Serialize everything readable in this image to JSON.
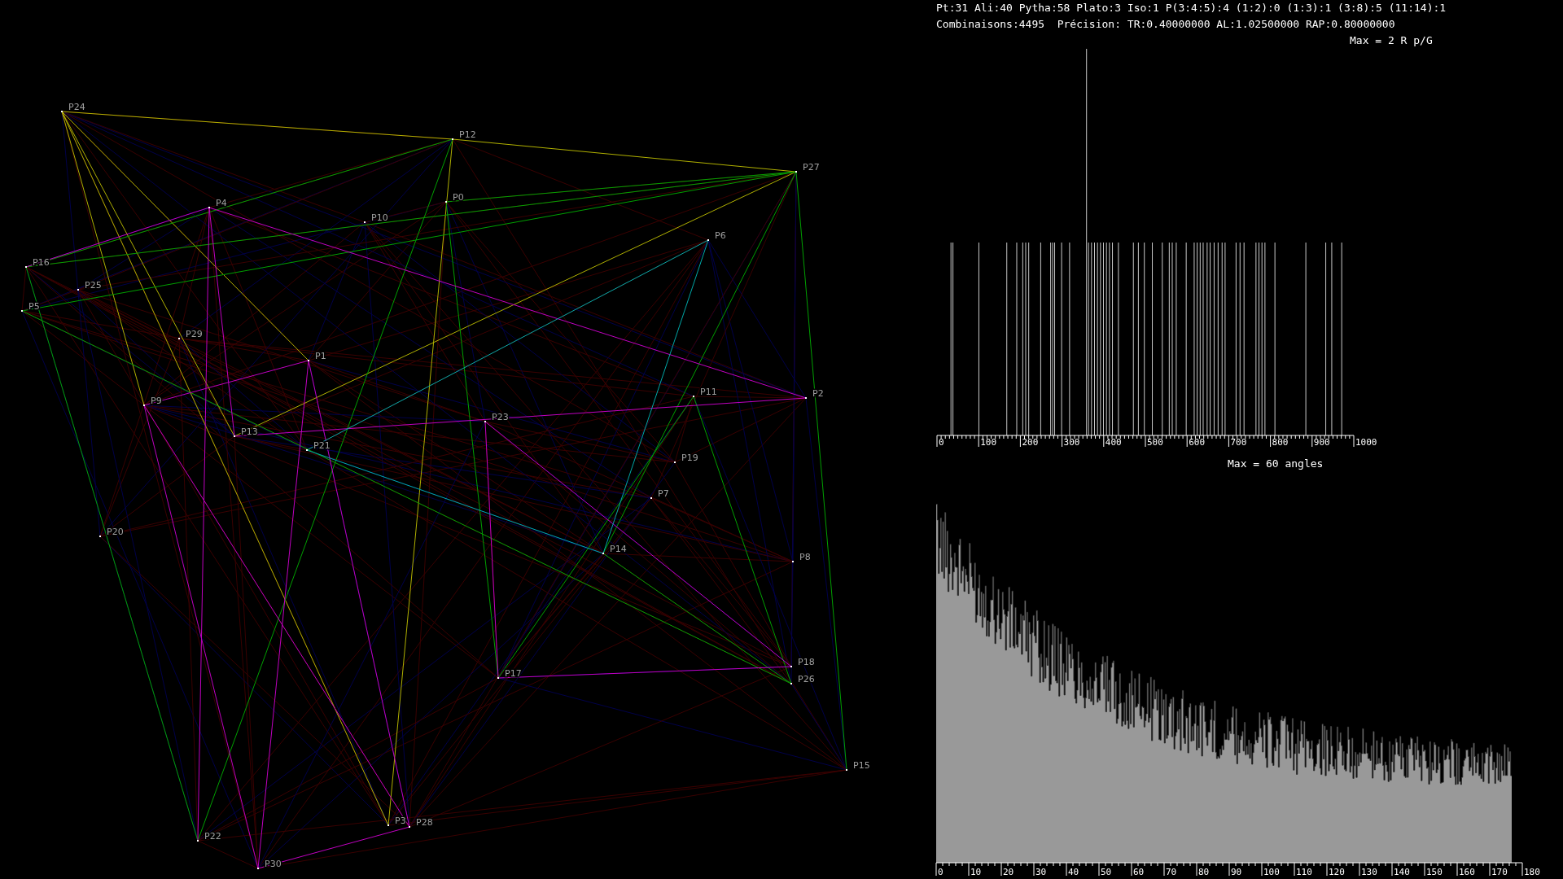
{
  "status": {
    "line_1": "Pt:31 Ali:40 Pytha:58 Plato:3 Iso:1 P(3:4:5):4 (1:2):0 (1:3):1 (3:8):5 (11:14):1",
    "line_2": "Combinaisons:4495  Précision: TR:0.40000000 AL:1.02500000 RAP:0.80000000"
  },
  "geometry_canvas": {
    "points": [
      {
        "label": "P0"
      },
      {
        "label": "P1"
      },
      {
        "label": "P2"
      },
      {
        "label": "P3"
      },
      {
        "label": "P4"
      },
      {
        "label": "P5"
      },
      {
        "label": "P6"
      },
      {
        "label": "P7"
      },
      {
        "label": "P8"
      },
      {
        "label": "P9"
      },
      {
        "label": "P10"
      },
      {
        "label": "P11"
      },
      {
        "label": "P12"
      },
      {
        "label": "P13"
      },
      {
        "label": "P14"
      },
      {
        "label": "P15"
      },
      {
        "label": "P16"
      },
      {
        "label": "P17"
      },
      {
        "label": "P18"
      },
      {
        "label": "P19"
      },
      {
        "label": "P20"
      },
      {
        "label": "P21"
      },
      {
        "label": "P22"
      },
      {
        "label": "P23"
      },
      {
        "label": "P24"
      },
      {
        "label": "P25"
      },
      {
        "label": "P26"
      },
      {
        "label": "P27"
      },
      {
        "label": "P28"
      },
      {
        "label": "P29"
      },
      {
        "label": "P30"
      }
    ]
  },
  "distance_histogram": {
    "title": "Max = 2 R p/G",
    "x_tick_labels": [
      "0",
      "100",
      "200",
      "300",
      "400",
      "500",
      "600",
      "700",
      "800",
      "900",
      "1000"
    ]
  },
  "angle_histogram": {
    "title": "Max = 60 angles",
    "x_tick_labels": [
      "0",
      "10",
      "20",
      "30",
      "40",
      "50",
      "60",
      "70",
      "80",
      "90",
      "100",
      "110",
      "120",
      "130",
      "140",
      "150",
      "160",
      "170",
      "180"
    ]
  }
}
